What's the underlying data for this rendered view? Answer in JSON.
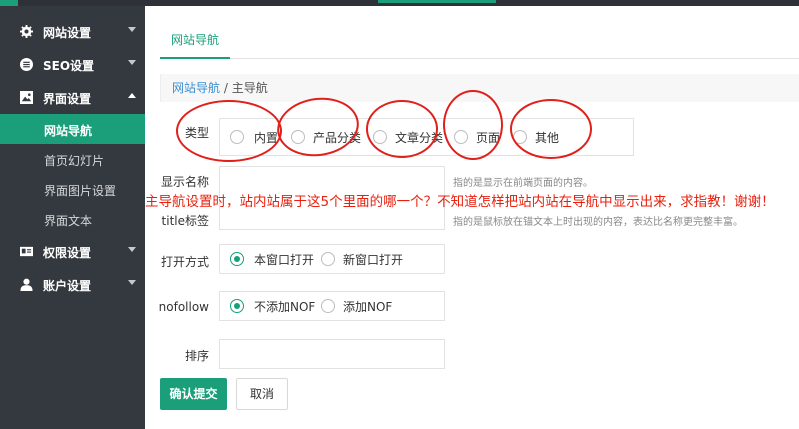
{
  "sidebar": {
    "items": [
      {
        "label": "网站设置",
        "icon": "gear-icon"
      },
      {
        "label": "SEO设置",
        "icon": "list-icon"
      },
      {
        "label": "界面设置",
        "icon": "image-icon"
      },
      {
        "label": "权限设置",
        "icon": "id-card-icon"
      },
      {
        "label": "账户设置",
        "icon": "user-icon"
      }
    ],
    "sub_items": [
      "网站导航",
      "首页幻灯片",
      "界面图片设置",
      "界面文本"
    ]
  },
  "tabs": [
    "网站导航"
  ],
  "breadcrumb": {
    "link": "网站导航",
    "separator": " / ",
    "current": "主导航"
  },
  "form": {
    "type": {
      "label": "类型",
      "options": [
        "内置",
        "产品分类",
        "文章分类",
        "页面",
        "其他"
      ]
    },
    "display_name": {
      "label": "显示名称",
      "value": "",
      "hint": "指的是显示在前端页面的内容。"
    },
    "title_tag": {
      "label": "title标签",
      "value": "",
      "hint": "指的是鼠标放在锚文本上时出现的内容，表达比名称更完整丰富。"
    },
    "open_mode": {
      "label": "打开方式",
      "options": [
        "本窗口打开",
        "新窗口打开"
      ],
      "selected": "本窗口打开"
    },
    "nofollow": {
      "label": "nofollow",
      "options": [
        "不添加NOF",
        "添加NOF"
      ],
      "selected": "不添加NOF"
    },
    "sort": {
      "label": "排序",
      "value": ""
    }
  },
  "annotation": "主导航设置时，站内站属于这5个里面的哪一个？不知道怎样把站内站在导航中显示出来，求指教！谢谢！",
  "buttons": {
    "submit": "确认提交",
    "cancel": "取消"
  },
  "colors": {
    "accent": "#1a9f7a",
    "sidebar": "#34393f",
    "annotation": "#e8210f"
  }
}
